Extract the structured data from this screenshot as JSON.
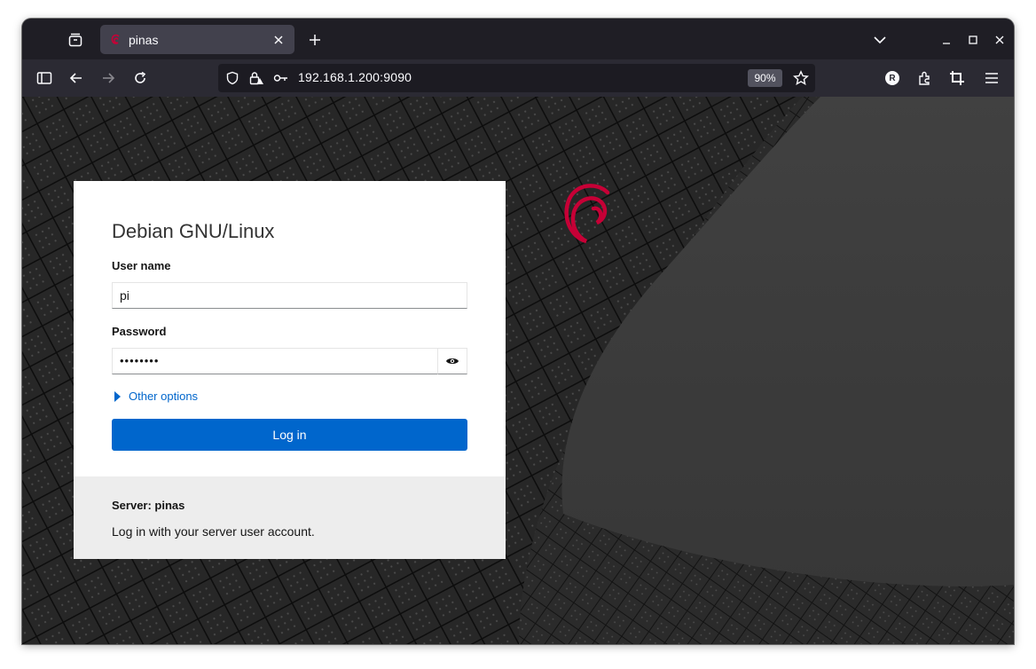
{
  "browser": {
    "tab": {
      "title": "pinas"
    },
    "url": "192.168.1.200:9090",
    "zoom": "90%",
    "profile_initial": "R"
  },
  "login": {
    "brand": "Debian GNU/Linux",
    "username_label": "User name",
    "username_value": "pi",
    "password_label": "Password",
    "password_mask": "••••••••",
    "other_options": "Other options",
    "login_button": "Log in",
    "server_label": "Server: pinas",
    "server_hint": "Log in with your server user account."
  },
  "colors": {
    "accent": "#0066cc",
    "debian_red": "#c70036"
  }
}
